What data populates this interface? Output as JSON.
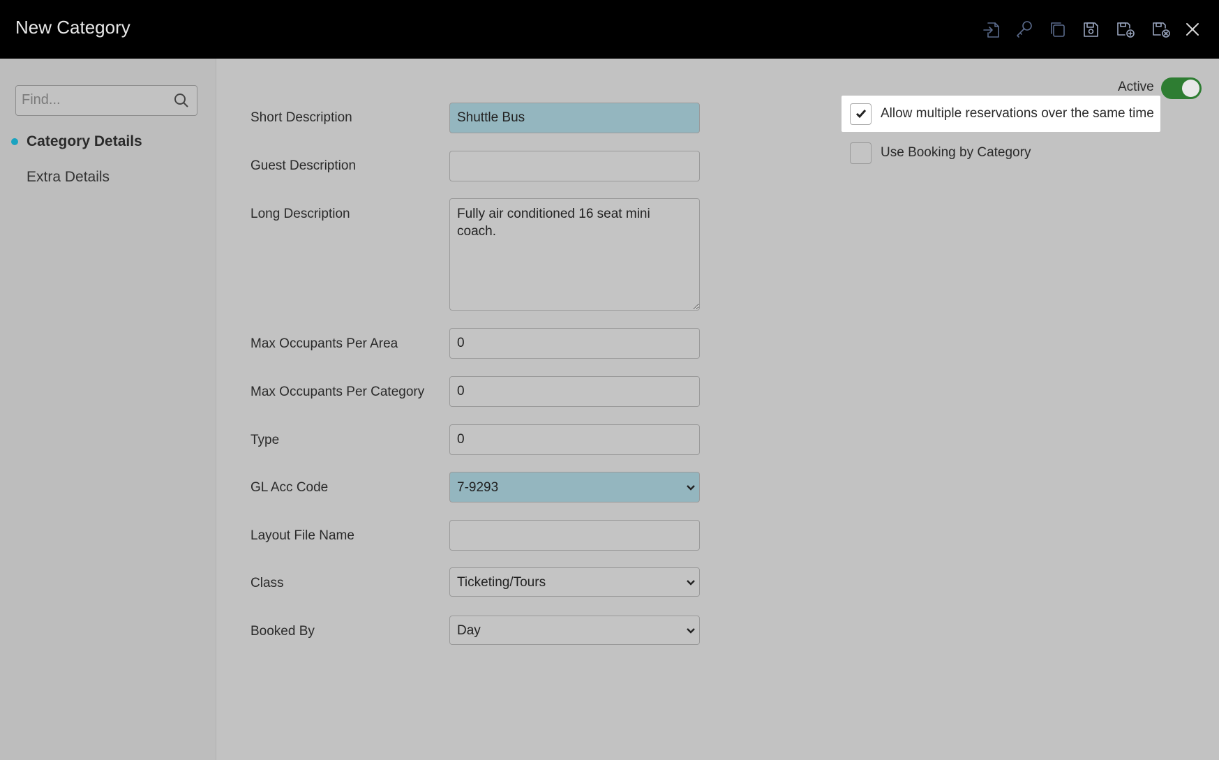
{
  "window": {
    "title": "New Category"
  },
  "toolbar": {
    "icons": [
      "import-icon",
      "key-icon",
      "copy-icon",
      "save-icon",
      "save-and-new-icon",
      "save-and-close-icon",
      "close-icon"
    ]
  },
  "sidebar": {
    "search_placeholder": "Find...",
    "items": [
      {
        "label": "Category Details",
        "active": true
      },
      {
        "label": "Extra Details",
        "active": false
      }
    ]
  },
  "form": {
    "short_description": {
      "label": "Short Description",
      "value": "Shuttle Bus"
    },
    "guest_description": {
      "label": "Guest Description",
      "value": ""
    },
    "long_description": {
      "label": "Long Description",
      "value": "Fully air conditioned 16 seat mini coach."
    },
    "max_occupants_area": {
      "label": "Max Occupants Per Area",
      "value": "0"
    },
    "max_occupants_category": {
      "label": "Max Occupants Per Category",
      "value": "0"
    },
    "type": {
      "label": "Type",
      "value": "0"
    },
    "gl_acc_code": {
      "label": "GL Acc Code",
      "value": "7-9293"
    },
    "layout_file_name": {
      "label": "Layout File Name",
      "value": ""
    },
    "class": {
      "label": "Class",
      "value": "Ticketing/Tours"
    },
    "booked_by": {
      "label": "Booked By",
      "value": "Day"
    }
  },
  "options": {
    "active_label": "Active",
    "active": true,
    "allow_multiple": {
      "label": "Allow multiple reservations over the same time",
      "checked": true
    },
    "booking_by_category": {
      "label": "Use Booking by Category",
      "checked": false
    }
  },
  "colors": {
    "highlight_field": "#94b6bf",
    "toggle_on": "#2e7d32",
    "nav_dot": "#1aa3c0"
  }
}
